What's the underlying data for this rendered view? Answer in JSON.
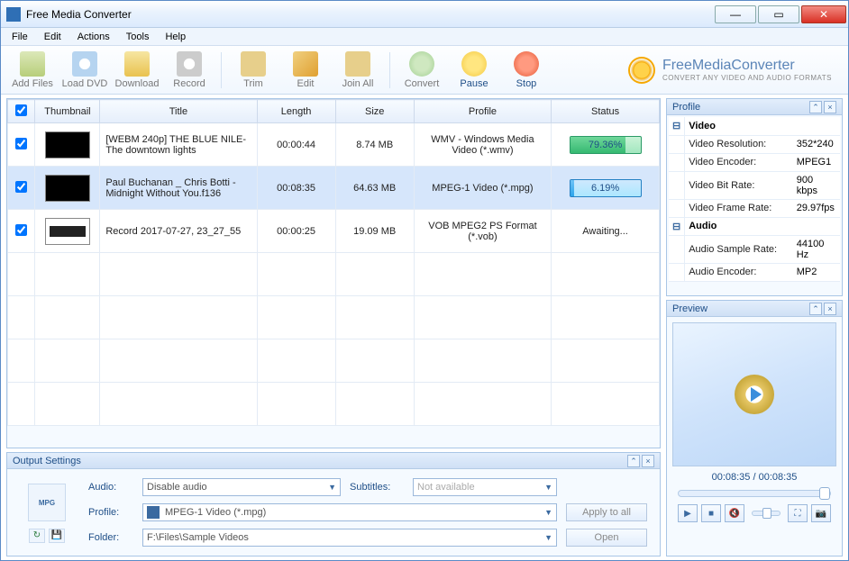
{
  "window": {
    "title": "Free Media Converter"
  },
  "menu": {
    "file": "File",
    "edit": "Edit",
    "actions": "Actions",
    "tools": "Tools",
    "help": "Help"
  },
  "toolbar": {
    "add": "Add Files",
    "dvd": "Load DVD",
    "download": "Download",
    "record": "Record",
    "trim": "Trim",
    "editbtn": "Edit",
    "join": "Join All",
    "convert": "Convert",
    "pause": "Pause",
    "stop": "Stop"
  },
  "brand": {
    "name": "FreeMediaConverter",
    "tag": "CONVERT ANY VIDEO AND AUDIO FORMATS"
  },
  "columns": {
    "thumb": "Thumbnail",
    "title": "Title",
    "length": "Length",
    "size": "Size",
    "profile": "Profile",
    "status": "Status"
  },
  "rows": [
    {
      "title": "[WEBM 240p] THE BLUE NILE-The downtown lights",
      "length": "00:00:44",
      "size": "8.74 MB",
      "profile": "WMV - Windows Media Video (*.wmv)",
      "status": "79.36%",
      "checked": true,
      "selected": false,
      "progress": 79.36,
      "mode": "progress",
      "thumb": "vid"
    },
    {
      "title": "Paul Buchanan _ Chris Botti - Midnight Without You.f136",
      "length": "00:08:35",
      "size": "64.63 MB",
      "profile": "MPEG-1 Video (*.mpg)",
      "status": "6.19%",
      "checked": true,
      "selected": true,
      "progress": 6.19,
      "mode": "progress",
      "thumb": "vid"
    },
    {
      "title": "Record 2017-07-27, 23_27_55",
      "length": "00:00:25",
      "size": "19.09 MB",
      "profile": "VOB MPEG2 PS Format (*.vob)",
      "status": "Awaiting...",
      "checked": true,
      "selected": false,
      "mode": "text",
      "thumb": "rec"
    }
  ],
  "output": {
    "panel": "Output Settings",
    "audio_l": "Audio:",
    "audio_v": "Disable audio",
    "subs_l": "Subtitles:",
    "subs_v": "Not available",
    "profile_l": "Profile:",
    "profile_v": "MPEG-1 Video (*.mpg)",
    "folder_l": "Folder:",
    "folder_v": "F:\\Files\\Sample Videos",
    "apply": "Apply to all",
    "open": "Open",
    "format_badge": "MPG"
  },
  "profile": {
    "panel": "Profile",
    "video": "Video",
    "audio": "Audio",
    "props": [
      {
        "k": "Video Resolution:",
        "v": "352*240"
      },
      {
        "k": "Video Encoder:",
        "v": "MPEG1"
      },
      {
        "k": "Video Bit Rate:",
        "v": "900 kbps"
      },
      {
        "k": "Video Frame Rate:",
        "v": "29.97fps"
      }
    ],
    "aprops": [
      {
        "k": "Audio Sample Rate:",
        "v": "44100 Hz"
      },
      {
        "k": "Audio Encoder:",
        "v": "MP2"
      }
    ]
  },
  "preview": {
    "panel": "Preview",
    "time": "00:08:35 / 00:08:35"
  }
}
